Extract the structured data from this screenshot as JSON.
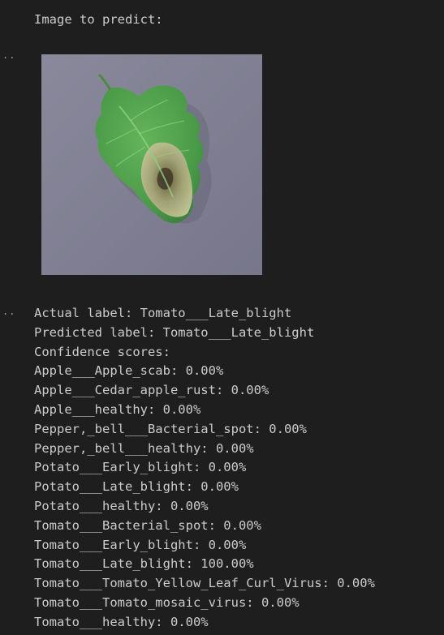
{
  "header": {
    "title": "Image to predict:"
  },
  "gutter": {
    "cell1_marker": "..",
    "cell2_marker": ".."
  },
  "image": {
    "subject": "tomato-leaf-with-late-blight",
    "background_color": "#7f7e91",
    "leaf_color": "#4e9a4a",
    "lesion_color": "#b9b48a"
  },
  "results": {
    "actual_line": "Actual label: Tomato___Late_blight",
    "predicted_line": "Predicted label: Tomato___Late_blight",
    "confidence_header": "Confidence scores:",
    "scores": [
      "Apple___Apple_scab: 0.00%",
      "Apple___Cedar_apple_rust: 0.00%",
      "Apple___healthy: 0.00%",
      "Pepper,_bell___Bacterial_spot: 0.00%",
      "Pepper,_bell___healthy: 0.00%",
      "Potato___Early_blight: 0.00%",
      "Potato___Late_blight: 0.00%",
      "Potato___healthy: 0.00%",
      "Tomato___Bacterial_spot: 0.00%",
      "Tomato___Early_blight: 0.00%",
      "Tomato___Late_blight: 100.00%",
      "Tomato___Tomato_Yellow_Leaf_Curl_Virus: 0.00%",
      "Tomato___Tomato_mosaic_virus: 0.00%",
      "Tomato___healthy: 0.00%"
    ]
  }
}
